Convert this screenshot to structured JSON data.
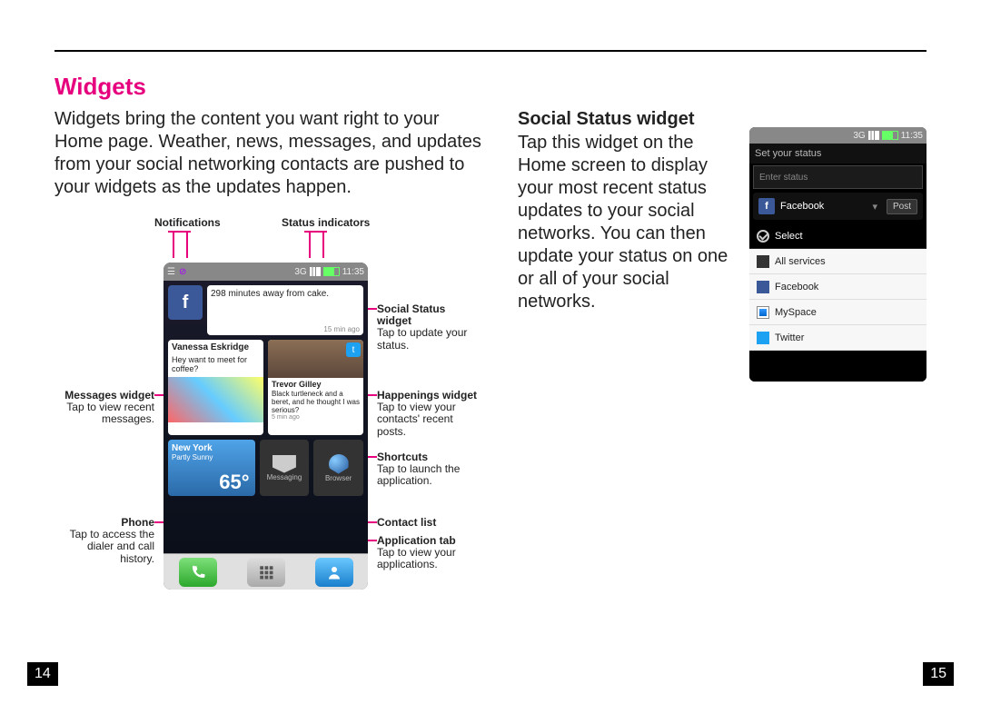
{
  "left": {
    "title": "Widgets",
    "body": "Widgets bring the content you want right to your Home page. Weather, news, messages, and updates from your social networking contacts are pushed to your widgets as the updates happen."
  },
  "right": {
    "title": "Social Status widget",
    "body": "Tap this widget on the Home screen to display your most recent status updates to your social networks. You can then update your status on one or all of your social networks."
  },
  "labels": {
    "notifications": "Notifications",
    "status_indicators": "Status indicators",
    "social_status_b": "Social Status widget",
    "social_status_t": "Tap to update your status.",
    "messages_b": "Messages widget",
    "messages_t": "Tap to view recent messages.",
    "happenings_b": "Happenings widget",
    "happenings_t": "Tap to view your contacts' recent posts.",
    "shortcuts_b": "Shortcuts",
    "shortcuts_t": "Tap to launch the application.",
    "phone_b": "Phone",
    "phone_t": "Tap to access the dialer and call history.",
    "contact_b": "Contact list",
    "app_b": "Application tab",
    "app_t": "Tap to view your applications."
  },
  "phone": {
    "time": "11:35",
    "net": "3G",
    "status_text": "298 minutes away from cake.",
    "status_meta": "15 min ago",
    "msg_name": "Vanessa Eskridge",
    "msg_text": "Hey want to meet for coffee?",
    "hap_name": "Trevor Gilley",
    "hap_text": "Black turtleneck and a beret, and he thought I was serious?",
    "hap_meta": "5 min ago",
    "weather_city": "New York",
    "weather_cond": "Partly Sunny",
    "weather_temp": "65°",
    "sc_msg": "Messaging",
    "sc_browser": "Browser"
  },
  "rphone": {
    "title": "Set your status",
    "placeholder": "Enter status",
    "primary": "Facebook",
    "post": "Post",
    "select": "Select",
    "items": [
      "All services",
      "Facebook",
      "MySpace",
      "Twitter"
    ],
    "time": "11:35",
    "net": "3G"
  },
  "pages": {
    "left": "14",
    "right": "15"
  }
}
